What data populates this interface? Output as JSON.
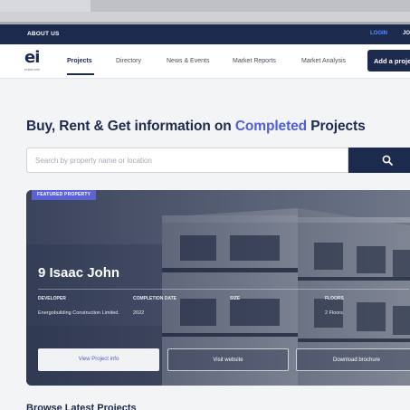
{
  "topbar": {
    "about": "ABOUT US",
    "login": "LOGIN",
    "join": "JO"
  },
  "nav": {
    "logo_mark": "ei",
    "logo_tagline": "estate intel",
    "items": [
      "Projects",
      "Directory",
      "News & Events",
      "Market Reports",
      "Market Analysis"
    ],
    "add_button": "Add a project"
  },
  "hero": {
    "title_prefix": "Buy, Rent & Get information on ",
    "title_highlight": "Completed",
    "title_suffix": " Projects"
  },
  "search": {
    "placeholder": "Search by property name or location",
    "icon": "search-icon"
  },
  "featured": {
    "badge": "FEATURED PROPERTY",
    "name": "9 Isaac John",
    "attributes": [
      {
        "label": "DEVELOPER",
        "value": "Energobuilding Construction Limited."
      },
      {
        "label": "COMPLETION DATE",
        "value": "2022"
      },
      {
        "label": "SIZE",
        "value": ""
      },
      {
        "label": "FLOORS",
        "value": "2 Floors"
      }
    ],
    "buttons": [
      "View Project info",
      "Visit website",
      "Download brochure"
    ]
  },
  "latest": {
    "title": "Browse Latest Projects"
  },
  "colors": {
    "navy": "#1c2a4d",
    "accent": "#4f5fd9",
    "badge": "#5b61d6",
    "login": "#5b8cff"
  }
}
